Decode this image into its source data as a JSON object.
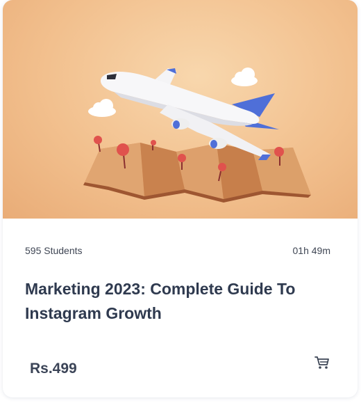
{
  "course": {
    "students": "595 Students",
    "duration": "01h 49m",
    "title": "Marketing 2023: Complete Guide To Instagram Growth",
    "price": "Rs.499"
  },
  "icons": {
    "cart": "shopping-cart-icon"
  },
  "colors": {
    "hero_background": "#f2c08e",
    "title_text": "#2f3a4f",
    "meta_text": "#3f4654"
  }
}
